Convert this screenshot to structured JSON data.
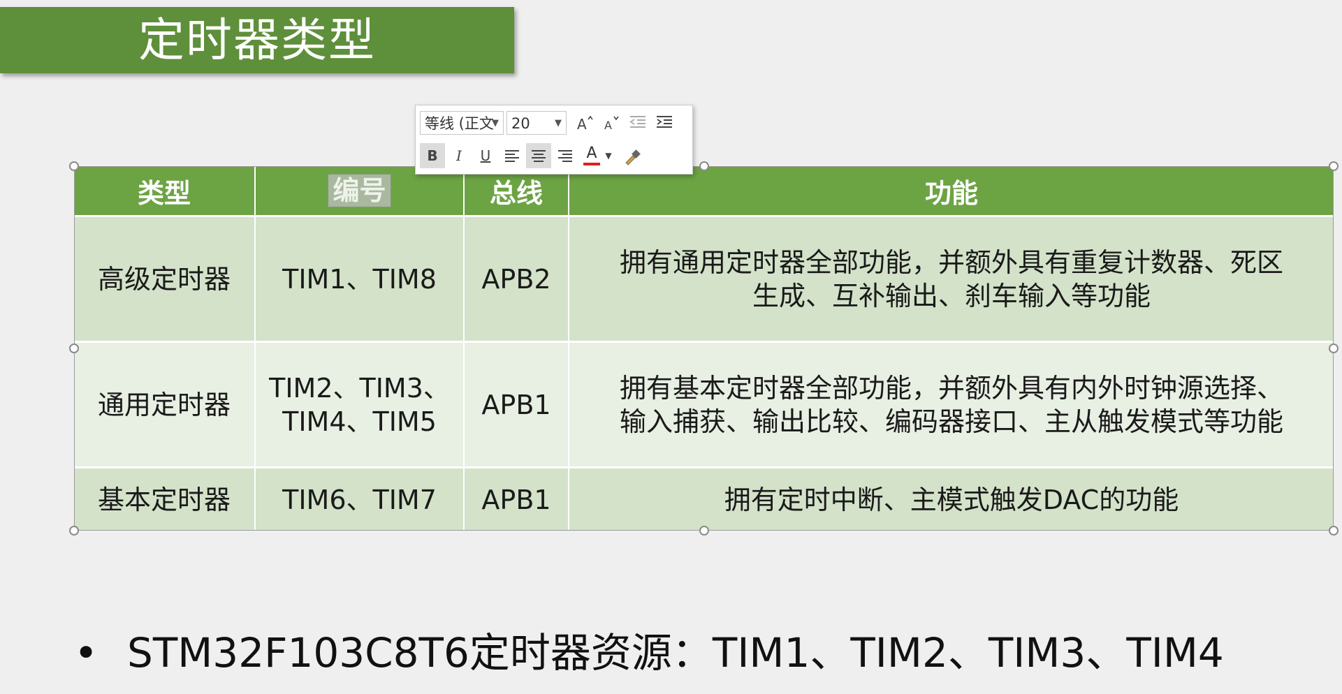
{
  "slide": {
    "title": "定时器类型",
    "bullet": "STM32F103C8T6定时器资源：TIM1、TIM2、TIM3、TIM4"
  },
  "toolbar": {
    "font_name": "等线 (正文",
    "font_size": "20",
    "bold": "B",
    "italic": "I",
    "underline": "U",
    "font_color_label": "A"
  },
  "table": {
    "headers": [
      "类型",
      "编号",
      "总线",
      "功能"
    ],
    "rows": [
      {
        "type": "高级定时器",
        "ids": "TIM1、TIM8",
        "bus": "APB2",
        "desc_line1": "拥有通用定时器全部功能，并额外具有重复计数器、死区",
        "desc_line2": "生成、互补输出、刹车输入等功能"
      },
      {
        "type": "通用定时器",
        "ids_line1": "TIM2、TIM3、",
        "ids_line2": "TIM4、TIM5",
        "bus": "APB1",
        "desc_line1": "拥有基本定时器全部功能，并额外具有内外时钟源选择、",
        "desc_line2": "输入捕获、输出比较、编码器接口、主从触发模式等功能"
      },
      {
        "type": "基本定时器",
        "ids": "TIM6、TIM7",
        "bus": "APB1",
        "desc": "拥有定时中断、主模式触发DAC的功能"
      }
    ]
  },
  "colors": {
    "banner": "#5e8f3a",
    "header": "#6ca343",
    "row_dark": "#d3e2c9",
    "row_light": "#e8efe3",
    "font_color_bar": "#e02020"
  }
}
